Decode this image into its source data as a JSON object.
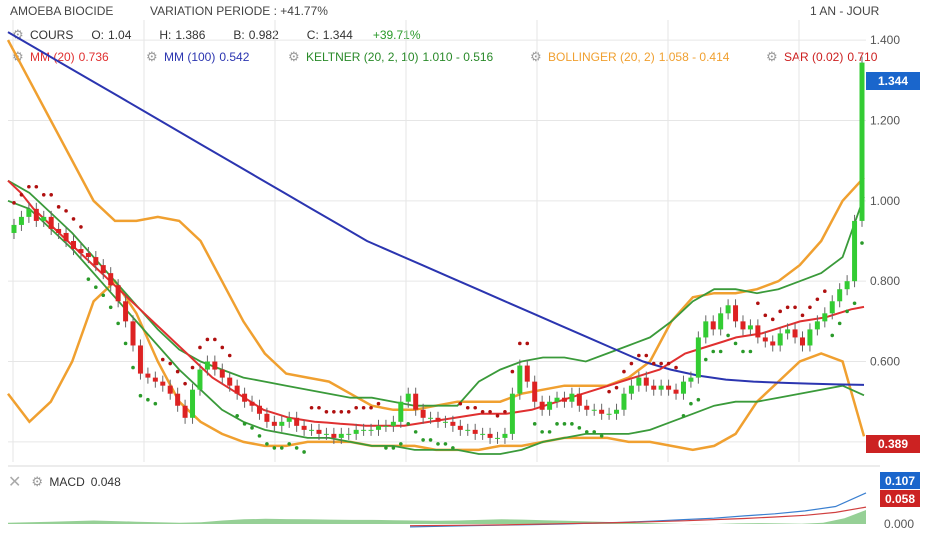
{
  "header": {
    "name": "AMOEBA BIOCIDE",
    "variation": "VARIATION PERIODE : +41.77%",
    "period": "1 AN - JOUR"
  },
  "legend": {
    "cours": {
      "label": "COURS",
      "o_label": "O:",
      "o": "1.04",
      "h_label": "H:",
      "h": "1.386",
      "b_label": "B:",
      "b": "0.982",
      "c_label": "C:",
      "c": "1.344",
      "change": "+39.71%"
    },
    "mm20": {
      "label": "MM (20)",
      "value": "0.736",
      "color": "#e03030"
    },
    "mm100": {
      "label": "MM (100)",
      "value": "0.542",
      "color": "#2b35b0"
    },
    "keltner": {
      "label": "KELTNER (20, 2, 10)",
      "value": "1.010 - 0.516",
      "color": "#3a9a3a"
    },
    "bollinger": {
      "label": "BOLLINGER (20, 2)",
      "value": "1.058 - 0.414",
      "color": "#f0a030"
    },
    "sar": {
      "label": "SAR (0.02)",
      "value": "0.710",
      "color": "#b01010"
    }
  },
  "macd": {
    "label": "MACD",
    "value": "0.048",
    "badge_top": "0.107",
    "badge_bottom": "0.058",
    "axis_zero": "0.000"
  },
  "chart_data": {
    "type": "candlestick",
    "ylim": [
      0.35,
      1.45
    ],
    "yticks": [
      "0.400",
      "0.600",
      "0.800",
      "1.000",
      "1.200",
      "1.400"
    ],
    "last_price_badge": "1.344",
    "low_badge": "0.389",
    "colors": {
      "up": "#33cc33",
      "down": "#dd2222",
      "badge_blue": "#1a66cc",
      "badge_red": "#cc2222",
      "grid": "#e6e6e6",
      "macd_area": "#7cc47c",
      "macd_line": "#3a7fd0",
      "signal_line": "#d04040"
    },
    "closes": [
      0.94,
      0.96,
      0.98,
      0.95,
      0.96,
      0.93,
      0.92,
      0.9,
      0.88,
      0.87,
      0.86,
      0.84,
      0.82,
      0.79,
      0.75,
      0.7,
      0.64,
      0.57,
      0.56,
      0.55,
      0.54,
      0.52,
      0.49,
      0.46,
      0.53,
      0.58,
      0.6,
      0.58,
      0.56,
      0.54,
      0.52,
      0.5,
      0.49,
      0.47,
      0.45,
      0.44,
      0.45,
      0.46,
      0.44,
      0.43,
      0.43,
      0.42,
      0.42,
      0.41,
      0.42,
      0.42,
      0.43,
      0.43,
      0.43,
      0.44,
      0.44,
      0.45,
      0.5,
      0.52,
      0.48,
      0.46,
      0.46,
      0.45,
      0.45,
      0.44,
      0.43,
      0.43,
      0.42,
      0.42,
      0.41,
      0.41,
      0.42,
      0.52,
      0.59,
      0.55,
      0.5,
      0.48,
      0.5,
      0.51,
      0.5,
      0.52,
      0.49,
      0.48,
      0.48,
      0.47,
      0.47,
      0.48,
      0.52,
      0.54,
      0.56,
      0.54,
      0.53,
      0.54,
      0.53,
      0.52,
      0.55,
      0.56,
      0.66,
      0.7,
      0.68,
      0.72,
      0.74,
      0.7,
      0.68,
      0.69,
      0.66,
      0.65,
      0.64,
      0.67,
      0.68,
      0.66,
      0.64,
      0.68,
      0.7,
      0.72,
      0.75,
      0.78,
      0.8,
      0.95,
      1.344
    ],
    "mm20": [
      1.05,
      1.02,
      0.98,
      0.95,
      0.92,
      0.89,
      0.86,
      0.83,
      0.8,
      0.77,
      0.74,
      0.71,
      0.68,
      0.65,
      0.62,
      0.59,
      0.56,
      0.54,
      0.52,
      0.5,
      0.48,
      0.47,
      0.46,
      0.455,
      0.45,
      0.448,
      0.445,
      0.443,
      0.44,
      0.44,
      0.44,
      0.44,
      0.445,
      0.45,
      0.455,
      0.46,
      0.465,
      0.47,
      0.47,
      0.47,
      0.475,
      0.48,
      0.49,
      0.5,
      0.51,
      0.52,
      0.53,
      0.54,
      0.55,
      0.56,
      0.57,
      0.58,
      0.6,
      0.62,
      0.63,
      0.64,
      0.65,
      0.66,
      0.665,
      0.67,
      0.68,
      0.69,
      0.7,
      0.705,
      0.71,
      0.72,
      0.73,
      0.736
    ],
    "mm100": [
      1.42,
      1.38,
      1.34,
      1.3,
      1.26,
      1.22,
      1.18,
      1.14,
      1.1,
      1.06,
      1.02,
      0.98,
      0.94,
      0.9,
      0.87,
      0.84,
      0.81,
      0.78,
      0.75,
      0.72,
      0.69,
      0.66,
      0.63,
      0.6,
      0.58,
      0.565,
      0.555,
      0.55,
      0.547,
      0.545,
      0.543,
      0.542
    ],
    "keltner_upper": [
      1.05,
      1.02,
      0.97,
      0.92,
      0.86,
      0.8,
      0.74,
      0.68,
      0.63,
      0.6,
      0.58,
      0.56,
      0.55,
      0.54,
      0.53,
      0.52,
      0.51,
      0.51,
      0.5,
      0.49,
      0.49,
      0.49,
      0.55,
      0.58,
      0.6,
      0.61,
      0.61,
      0.6,
      0.62,
      0.64,
      0.66,
      0.7,
      0.75,
      0.78,
      0.78,
      0.77,
      0.78,
      0.8,
      0.82,
      0.86,
      1.01
    ],
    "keltner_lower": [
      1.0,
      0.98,
      0.93,
      0.88,
      0.82,
      0.76,
      0.7,
      0.64,
      0.58,
      0.53,
      0.48,
      0.45,
      0.43,
      0.42,
      0.41,
      0.41,
      0.4,
      0.39,
      0.39,
      0.38,
      0.38,
      0.38,
      0.37,
      0.37,
      0.38,
      0.4,
      0.41,
      0.42,
      0.42,
      0.42,
      0.43,
      0.45,
      0.47,
      0.49,
      0.5,
      0.5,
      0.51,
      0.52,
      0.53,
      0.54,
      0.516
    ],
    "bollinger_upper": [
      1.4,
      1.3,
      1.2,
      1.1,
      1.0,
      0.95,
      0.95,
      0.96,
      0.95,
      0.9,
      0.8,
      0.7,
      0.62,
      0.57,
      0.56,
      0.55,
      0.52,
      0.49,
      0.48,
      0.48,
      0.49,
      0.5,
      0.5,
      0.5,
      0.52,
      0.53,
      0.54,
      0.54,
      0.54,
      0.56,
      0.6,
      0.7,
      0.76,
      0.77,
      0.77,
      0.78,
      0.8,
      0.84,
      0.9,
      1.0,
      1.058
    ],
    "bollinger_lower": [
      0.52,
      0.45,
      0.5,
      0.6,
      0.75,
      0.8,
      0.72,
      0.6,
      0.5,
      0.45,
      0.42,
      0.4,
      0.39,
      0.39,
      0.4,
      0.4,
      0.4,
      0.39,
      0.39,
      0.39,
      0.38,
      0.38,
      0.38,
      0.39,
      0.39,
      0.4,
      0.41,
      0.41,
      0.41,
      0.4,
      0.4,
      0.39,
      0.38,
      0.39,
      0.42,
      0.5,
      0.55,
      0.6,
      0.62,
      0.6,
      0.414
    ],
    "macd_hist": [
      0.004,
      0.006,
      0.008,
      0.01,
      0.012,
      0.01,
      0.008,
      0.006,
      0.004,
      0.006,
      0.012,
      0.016,
      0.018,
      0.017,
      0.016,
      0.015,
      0.014,
      0.014,
      0.013,
      0.012,
      0.011,
      0.012,
      0.014,
      0.016,
      0.015,
      0.013,
      0.011,
      0.009,
      0.007,
      0.005,
      0.003,
      0.001,
      -0.001,
      0.0,
      0.002,
      0.003,
      0.002,
      0.001,
      0.004,
      0.02,
      0.048
    ],
    "macd_line": [
      -0.01,
      -0.008,
      -0.006,
      -0.004,
      -0.002,
      0.0,
      0.003,
      0.006,
      0.01,
      0.015,
      0.02,
      0.028,
      0.035,
      0.045,
      0.06,
      0.107
    ],
    "signal_line": [
      -0.006,
      -0.005,
      -0.004,
      -0.003,
      -0.001,
      0.001,
      0.003,
      0.005,
      0.008,
      0.011,
      0.015,
      0.019,
      0.024,
      0.03,
      0.04,
      0.058
    ]
  }
}
